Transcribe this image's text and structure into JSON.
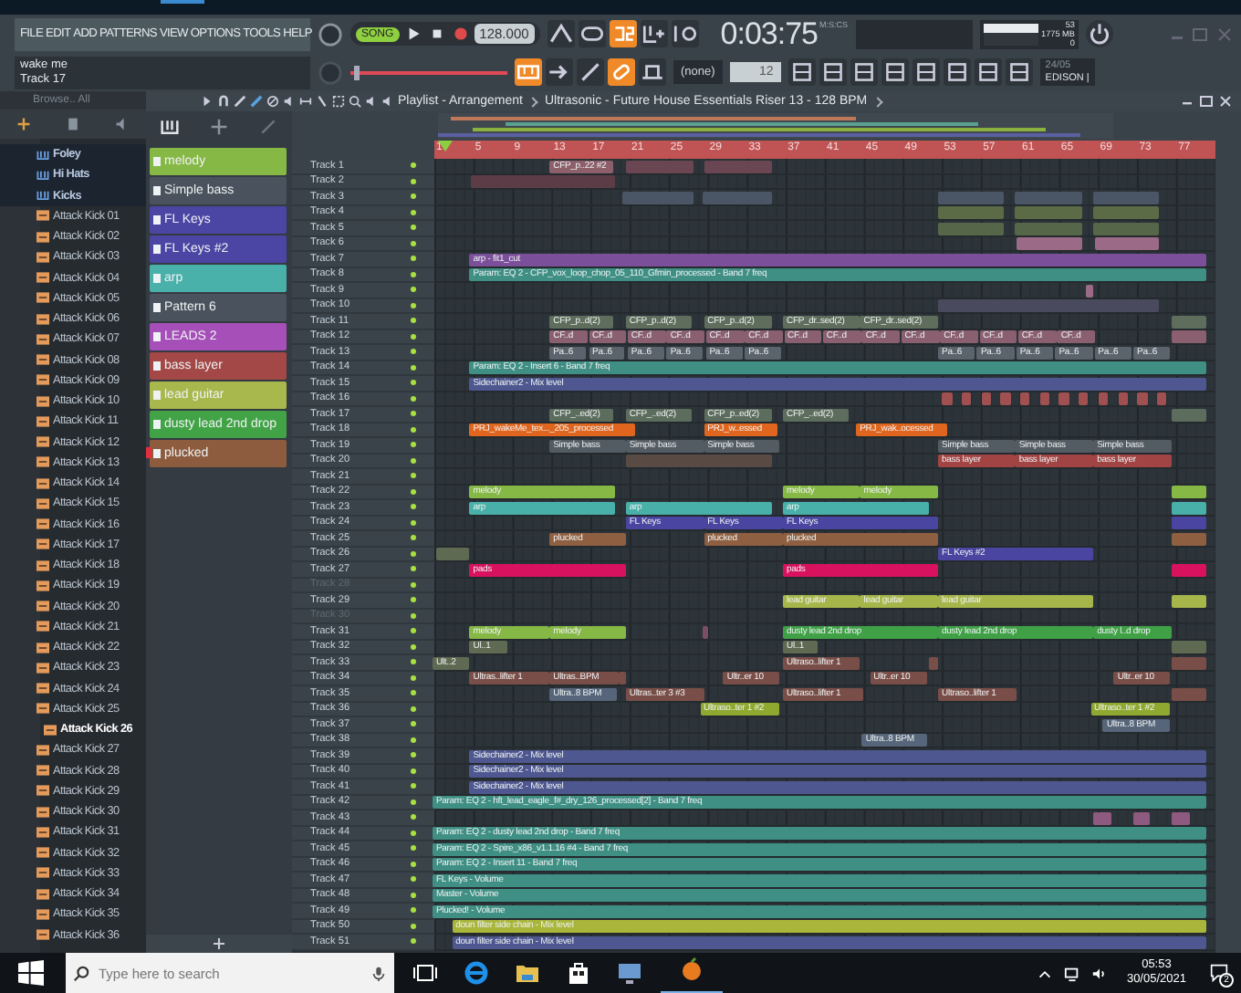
{
  "menu": [
    "FILE",
    "EDIT",
    "ADD",
    "PATTERNS",
    "VIEW",
    "OPTIONS",
    "TOOLS",
    "HELP"
  ],
  "transport": {
    "mode": "SONG",
    "song_mode": true,
    "tempo": "128.000",
    "time": "0:03:75",
    "time_unit": "M:S:CS",
    "cpu": "53",
    "memory": "1775 MB",
    "polyphony": "0"
  },
  "hint": {
    "title": "wake me",
    "subtitle": "Track 17"
  },
  "toolbar": {
    "pitch": {
      "level": 0.02
    },
    "snap": "(none)",
    "step": "12",
    "plugin_date": "24/05",
    "plugin_name": "EDISON |"
  },
  "browser": {
    "header": "Browse.. All",
    "items": [
      {
        "label": "Foley",
        "kind": "folder",
        "selected": false
      },
      {
        "label": "Hi Hats",
        "kind": "folder",
        "selected": false
      },
      {
        "label": "Kicks",
        "kind": "folder",
        "selected": false
      },
      {
        "label": "Attack Kick 01",
        "kind": "file",
        "selected": false
      },
      {
        "label": "Attack Kick 02",
        "kind": "file",
        "selected": false
      },
      {
        "label": "Attack Kick 03",
        "kind": "file",
        "selected": false
      },
      {
        "label": "Attack Kick 04",
        "kind": "file",
        "selected": false
      },
      {
        "label": "Attack Kick 05",
        "kind": "file",
        "selected": false
      },
      {
        "label": "Attack Kick 06",
        "kind": "file",
        "selected": false
      },
      {
        "label": "Attack Kick 07",
        "kind": "file",
        "selected": false
      },
      {
        "label": "Attack Kick 08",
        "kind": "file",
        "selected": false
      },
      {
        "label": "Attack Kick 09",
        "kind": "file",
        "selected": false
      },
      {
        "label": "Attack Kick 10",
        "kind": "file",
        "selected": false
      },
      {
        "label": "Attack Kick 11",
        "kind": "file",
        "selected": false
      },
      {
        "label": "Attack Kick 12",
        "kind": "file",
        "selected": false
      },
      {
        "label": "Attack Kick 13",
        "kind": "file",
        "selected": false
      },
      {
        "label": "Attack Kick 14",
        "kind": "file",
        "selected": false
      },
      {
        "label": "Attack Kick 15",
        "kind": "file",
        "selected": false
      },
      {
        "label": "Attack Kick 16",
        "kind": "file",
        "selected": false
      },
      {
        "label": "Attack Kick 17",
        "kind": "file",
        "selected": false
      },
      {
        "label": "Attack Kick 18",
        "kind": "file",
        "selected": false
      },
      {
        "label": "Attack Kick 19",
        "kind": "file",
        "selected": false
      },
      {
        "label": "Attack Kick 20",
        "kind": "file",
        "selected": false
      },
      {
        "label": "Attack Kick 21",
        "kind": "file",
        "selected": false
      },
      {
        "label": "Attack Kick 22",
        "kind": "file",
        "selected": false
      },
      {
        "label": "Attack Kick 23",
        "kind": "file",
        "selected": false
      },
      {
        "label": "Attack Kick 24",
        "kind": "file",
        "selected": false
      },
      {
        "label": "Attack Kick 25",
        "kind": "file",
        "selected": false
      },
      {
        "label": "Attack Kick 26",
        "kind": "file",
        "selected": true
      },
      {
        "label": "Attack Kick 27",
        "kind": "file",
        "selected": false
      },
      {
        "label": "Attack Kick 28",
        "kind": "file",
        "selected": false
      },
      {
        "label": "Attack Kick 29",
        "kind": "file",
        "selected": false
      },
      {
        "label": "Attack Kick 30",
        "kind": "file",
        "selected": false
      },
      {
        "label": "Attack Kick 31",
        "kind": "file",
        "selected": false
      },
      {
        "label": "Attack Kick 32",
        "kind": "file",
        "selected": false
      },
      {
        "label": "Attack Kick 33",
        "kind": "file",
        "selected": false
      },
      {
        "label": "Attack Kick 34",
        "kind": "file",
        "selected": false
      },
      {
        "label": "Attack Kick 35",
        "kind": "file",
        "selected": false
      },
      {
        "label": "Attack Kick 36",
        "kind": "file",
        "selected": false
      }
    ]
  },
  "patterns": [
    {
      "label": "melody",
      "color": "#86b845",
      "selected": false
    },
    {
      "label": "Simple bass",
      "color": "#4a535d",
      "selected": false
    },
    {
      "label": "FL Keys",
      "color": "#4b45a3",
      "selected": false
    },
    {
      "label": "FL Keys #2",
      "color": "#4b45a3",
      "selected": false
    },
    {
      "label": "arp",
      "color": "#49b0aa",
      "selected": false
    },
    {
      "label": "Pattern 6",
      "color": "#4a535d",
      "selected": false
    },
    {
      "label": "LEADS 2",
      "color": "#a64fb8",
      "selected": false
    },
    {
      "label": "bass layer",
      "color": "#a44747",
      "selected": false
    },
    {
      "label": "lead guitar",
      "color": "#a8b84c",
      "selected": false
    },
    {
      "label": "dusty lead 2nd drop",
      "color": "#41a345",
      "selected": false
    },
    {
      "label": "plucked",
      "color": "#8d5c3f",
      "selected": true
    }
  ],
  "playlist": {
    "title": "Playlist - Arrangement",
    "song": "Ultrasonic - Future House Essentials Riser 13 - 128 BPM",
    "ruler": [
      "1",
      "5",
      "9",
      "13",
      "17",
      "21",
      "25",
      "29",
      "33",
      "37",
      "41",
      "45",
      "49",
      "53",
      "57",
      "61",
      "65",
      "69",
      "73",
      "77"
    ],
    "tracks": [
      {
        "name": "Track 1",
        "muted": false,
        "clips": [
          {
            "label": "CFP_p..22 #2",
            "color": "#8d5f6a"
          },
          {
            "color": "#6a4652"
          },
          {
            "color": "#6a4652"
          }
        ]
      },
      {
        "name": "Track 2",
        "muted": false,
        "clips": [
          {
            "color": "#5c3c46"
          }
        ]
      },
      {
        "name": "Track 3",
        "muted": false,
        "clips": [
          {
            "color": "#4a5566"
          },
          {
            "color": "#4a5566"
          },
          {
            "color": "#4a5566"
          },
          {
            "color": "#4a5566"
          },
          {
            "color": "#4a5566"
          }
        ]
      },
      {
        "name": "Track 4",
        "muted": false,
        "clips": [
          {
            "color": "#5b6b45"
          },
          {
            "color": "#5b6b45"
          },
          {
            "color": "#5b6b45"
          }
        ]
      },
      {
        "name": "Track 5",
        "muted": false,
        "clips": [
          {
            "color": "#566648"
          },
          {
            "color": "#566648"
          },
          {
            "color": "#566648"
          }
        ]
      },
      {
        "name": "Track 6",
        "muted": false,
        "clips": [
          {
            "color": "#9a6a86"
          },
          {
            "color": "#9a6a86"
          }
        ]
      },
      {
        "name": "Track 7",
        "muted": false,
        "clips": [
          {
            "label": "arp - fit1_cut",
            "color": "#7b4f9a"
          }
        ]
      },
      {
        "name": "Track 8",
        "muted": false,
        "clips": [
          {
            "label": "Param: EQ 2 - CFP_vox_loop_chop_05_110_Gfmin_processed - Band 7 freq",
            "color": "#3f8f84"
          }
        ]
      },
      {
        "name": "Track 9",
        "muted": false,
        "clips": [
          {
            "color": "#9a6a86"
          }
        ]
      },
      {
        "name": "Track 10",
        "muted": false,
        "clips": [
          {
            "color": "#4a4a5e"
          }
        ]
      },
      {
        "name": "Track 11",
        "muted": false,
        "clips": [
          {
            "label": "CFP_p..d(2)",
            "color": "#5f6e5c"
          },
          {
            "label": "CFP_p..d(2)",
            "color": "#5f6e5c"
          },
          {
            "label": "CFP_p..d(2)",
            "color": "#5f6e5c"
          },
          {
            "label": "CFP_dr..sed(2)",
            "color": "#5f6e5c"
          },
          {
            "label": "CFP_dr..sed(2)",
            "color": "#5f6e5c"
          },
          {
            "color": "#5f6e5c"
          }
        ]
      },
      {
        "name": "Track 12",
        "muted": false,
        "clips": [
          {
            "label": "CF..d",
            "color": "#8a6070"
          },
          {
            "label": "CF..d",
            "color": "#8a6070"
          },
          {
            "label": "CF..d",
            "color": "#8a6070"
          },
          {
            "label": "CF..d",
            "color": "#8a6070"
          },
          {
            "label": "CF..d",
            "color": "#8a6070"
          },
          {
            "label": "CF..d",
            "color": "#8a6070"
          },
          {
            "label": "CF..d",
            "color": "#8a6070"
          },
          {
            "label": "CF..d",
            "color": "#8a6070"
          },
          {
            "label": "CF..d",
            "color": "#8a6070"
          },
          {
            "label": "CF..d",
            "color": "#8a6070"
          },
          {
            "label": "CF..d",
            "color": "#8a6070"
          },
          {
            "label": "CF..d",
            "color": "#8a6070"
          },
          {
            "label": "CF..d",
            "color": "#8a6070"
          },
          {
            "label": "CF..d",
            "color": "#8a6070"
          },
          {
            "color": "#8a6070"
          }
        ]
      },
      {
        "name": "Track 13",
        "muted": false,
        "clips": [
          {
            "label": "Pa..6",
            "color": "#5b636c"
          },
          {
            "label": "Pa..6",
            "color": "#5b636c"
          },
          {
            "label": "Pa..6",
            "color": "#5b636c"
          },
          {
            "label": "Pa..6",
            "color": "#5b636c"
          },
          {
            "label": "Pa..6",
            "color": "#5b636c"
          },
          {
            "label": "Pa..6",
            "color": "#5b636c"
          },
          {
            "label": "Pa..6",
            "color": "#5b636c"
          },
          {
            "label": "Pa..6",
            "color": "#5b636c"
          },
          {
            "label": "Pa..6",
            "color": "#5b636c"
          },
          {
            "label": "Pa..6",
            "color": "#5b636c"
          },
          {
            "label": "Pa..6",
            "color": "#5b636c"
          },
          {
            "label": "Pa..6",
            "color": "#5b636c"
          }
        ]
      },
      {
        "name": "Track 14",
        "muted": false,
        "clips": [
          {
            "label": "Param: EQ 2 - Insert 6 - Band 7 freq",
            "color": "#3f8f84"
          }
        ]
      },
      {
        "name": "Track 15",
        "muted": false,
        "clips": [
          {
            "label": "Sidechainer2 - Mix level",
            "color": "#4e5790"
          }
        ]
      },
      {
        "name": "Track 16",
        "muted": false,
        "clips": [
          {
            "color": "#a05050"
          },
          {
            "color": "#a05050"
          },
          {
            "color": "#a05050"
          },
          {
            "color": "#a05050"
          },
          {
            "color": "#a05050"
          },
          {
            "color": "#a05050"
          },
          {
            "color": "#a05050"
          },
          {
            "color": "#a05050"
          },
          {
            "color": "#a05050"
          },
          {
            "color": "#a05050"
          },
          {
            "color": "#a05050"
          },
          {
            "color": "#a05050"
          }
        ]
      },
      {
        "name": "Track 17",
        "muted": false,
        "clips": [
          {
            "label": "CFP_..ed(2)",
            "color": "#5d6d5d"
          },
          {
            "label": "CFP_..ed(2)",
            "color": "#5d6d5d"
          },
          {
            "label": "CFP_p..ed(2)",
            "color": "#5d6d5d"
          },
          {
            "label": "CFP_..ed(2)",
            "color": "#5d6d5d"
          },
          {
            "color": "#5d6d5d"
          }
        ]
      },
      {
        "name": "Track 18",
        "muted": false,
        "clips": [
          {
            "label": "PRJ_wakeMe_tex..._205_processed",
            "color": "#e0661f"
          },
          {
            "label": "PRJ_w..essed",
            "color": "#e0661f"
          },
          {
            "label": "PRJ_wak..ocessed",
            "color": "#e0661f"
          }
        ]
      },
      {
        "name": "Track 19",
        "muted": false,
        "clips": [
          {
            "label": "Simple bass",
            "color": "#535b63"
          },
          {
            "label": "Simple bass",
            "color": "#535b63"
          },
          {
            "label": "Simple bass",
            "color": "#535b63"
          },
          {
            "label": "Simple bass",
            "color": "#535b63"
          },
          {
            "label": "Simple bass",
            "color": "#535b63"
          },
          {
            "label": "Simple bass",
            "color": "#535b63"
          }
        ]
      },
      {
        "name": "Track 20",
        "muted": false,
        "clips": [
          {
            "color": "#5a4a44"
          },
          {
            "label": "bass layer",
            "color": "#a24444"
          },
          {
            "label": "bass layer",
            "color": "#a24444"
          },
          {
            "label": "bass layer",
            "color": "#a24444"
          }
        ]
      },
      {
        "name": "Track 21",
        "muted": false
      },
      {
        "name": "Track 22",
        "muted": false,
        "clips": [
          {
            "label": "melody",
            "color": "#86b845"
          },
          {
            "label": "melody",
            "color": "#86b845"
          },
          {
            "label": "melody",
            "color": "#86b845"
          },
          {
            "color": "#86b845"
          }
        ]
      },
      {
        "name": "Track 23",
        "muted": false,
        "clips": [
          {
            "label": "arp",
            "color": "#48b0a8"
          },
          {
            "label": "arp",
            "color": "#48b0a8"
          },
          {
            "label": "arp",
            "color": "#48b0a8"
          },
          {
            "color": "#48b0a8"
          }
        ]
      },
      {
        "name": "Track 24",
        "muted": false,
        "clips": [
          {
            "label": "FL Keys",
            "color": "#4a45a0"
          },
          {
            "label": "FL Keys",
            "color": "#4a45a0"
          },
          {
            "label": "FL Keys",
            "color": "#4a45a0"
          },
          {
            "color": "#4a45a0"
          }
        ]
      },
      {
        "name": "Track 25",
        "muted": false,
        "clips": [
          {
            "label": "plucked",
            "color": "#8e5f40"
          },
          {
            "label": "plucked",
            "color": "#8e5f40"
          },
          {
            "label": "plucked",
            "color": "#8e5f40"
          },
          {
            "color": "#8e5f40"
          }
        ]
      },
      {
        "name": "Track 26",
        "muted": false,
        "clips": [
          {
            "color": "#5e6a52"
          },
          {
            "label": "FL Keys #2",
            "color": "#4a45a0"
          }
        ]
      },
      {
        "name": "Track 27",
        "muted": false,
        "clips": [
          {
            "label": "pads",
            "color": "#d8125e"
          },
          {
            "label": "pads",
            "color": "#d8125e"
          },
          {
            "color": "#d8125e"
          }
        ]
      },
      {
        "name": "Track 28",
        "muted": true
      },
      {
        "name": "Track 29",
        "muted": false,
        "clips": [
          {
            "label": "lead guitar",
            "color": "#a6b64a"
          },
          {
            "label": "lead guitar",
            "color": "#a6b64a"
          },
          {
            "label": "lead guitar",
            "color": "#a6b64a"
          },
          {
            "color": "#a6b64a"
          }
        ]
      },
      {
        "name": "Track 30",
        "muted": true
      },
      {
        "name": "Track 31",
        "muted": false,
        "clips": [
          {
            "label": "melody",
            "color": "#86b845"
          },
          {
            "label": "melody",
            "color": "#86b845"
          },
          {
            "color": "#7a4e68"
          },
          {
            "label": "dusty lead 2nd drop",
            "color": "#3fa046"
          },
          {
            "label": "dusty lead 2nd drop",
            "color": "#3fa046"
          },
          {
            "label": "dusty l..d drop",
            "color": "#3fa046"
          }
        ]
      },
      {
        "name": "Track 32",
        "muted": false,
        "clips": [
          {
            "label": "Ul..1",
            "color": "#5e6a52"
          },
          {
            "label": "Ul..1",
            "color": "#5e6a52"
          },
          {
            "color": "#5e6a52"
          }
        ]
      },
      {
        "name": "Track 33",
        "muted": false,
        "clips": [
          {
            "label": "Ult..2",
            "color": "#5e6a52"
          },
          {
            "label": "Ultraso..lifter 1",
            "color": "#7a4e48"
          },
          {
            "color": "#7a4e48"
          },
          {
            "color": "#7a4e48"
          }
        ]
      },
      {
        "name": "Track 34",
        "muted": false,
        "clips": [
          {
            "label": "Ultras..lifter 1",
            "color": "#7a4e48"
          },
          {
            "label": "Ultras..BPM",
            "color": "#7a4e48"
          },
          {
            "color": "#7a4e48"
          },
          {
            "label": "Ultr..er 10",
            "color": "#7a4e48"
          },
          {
            "label": "Ultr..er 10",
            "color": "#7a4e48"
          },
          {
            "label": "Ultr..er 10",
            "color": "#7a4e48"
          }
        ]
      },
      {
        "name": "Track 35",
        "muted": false,
        "clips": [
          {
            "label": "Ultra..8 BPM",
            "color": "#56657a"
          },
          {
            "label": "Ultras..ter 3 #3",
            "color": "#7a4e48"
          },
          {
            "label": "Ultraso..lifter 1",
            "color": "#7a4e48"
          },
          {
            "label": "Ultraso..lifter 1",
            "color": "#7a4e48"
          },
          {
            "color": "#7a4e48"
          }
        ]
      },
      {
        "name": "Track 36",
        "muted": false,
        "clips": [
          {
            "label": "Ultraso..ter 1 #2",
            "color": "#8fa830"
          },
          {
            "label": "Ultraso..ter 1 #2",
            "color": "#8fa830"
          }
        ]
      },
      {
        "name": "Track 37",
        "muted": false,
        "clips": [
          {
            "label": "Ultra..8 BPM",
            "color": "#56657a"
          }
        ]
      },
      {
        "name": "Track 38",
        "muted": false,
        "clips": [
          {
            "label": "Ultra..8 BPM",
            "color": "#56657a"
          }
        ]
      },
      {
        "name": "Track 39",
        "muted": false,
        "clips": [
          {
            "label": "Sidechainer2 - Mix level",
            "color": "#4e5790"
          }
        ]
      },
      {
        "name": "Track 40",
        "muted": false,
        "clips": [
          {
            "label": "Sidechainer2 - Mix level",
            "color": "#4e5790"
          }
        ]
      },
      {
        "name": "Track 41",
        "muted": false,
        "clips": [
          {
            "label": "Sidechainer2 - Mix level",
            "color": "#4e5790"
          }
        ]
      },
      {
        "name": "Track 42",
        "muted": false,
        "clips": [
          {
            "label": "Param: EQ 2 - hft_lead_eagle_f#_dry_126_processed[2] - Band 7 freq",
            "color": "#3f8f84"
          }
        ]
      },
      {
        "name": "Track 43",
        "muted": false,
        "clips": [
          {
            "color": "#8e5a80"
          },
          {
            "color": "#8e5a80"
          },
          {
            "color": "#8e5a80"
          }
        ]
      },
      {
        "name": "Track 44",
        "muted": false,
        "clips": [
          {
            "label": "Param: EQ 2 - dusty lead 2nd drop - Band 7 freq",
            "color": "#3f8f84"
          }
        ]
      },
      {
        "name": "Track 45",
        "muted": false,
        "clips": [
          {
            "label": "Param: EQ 2 - Spire_x86_v1.1.16 #4 - Band 7 freq",
            "color": "#3f8f84"
          }
        ]
      },
      {
        "name": "Track 46",
        "muted": false,
        "clips": [
          {
            "label": "Param: EQ 2 - Insert 11 - Band 7 freq",
            "color": "#3f8f84"
          }
        ]
      },
      {
        "name": "Track 47",
        "muted": false,
        "clips": [
          {
            "label": "FL Keys - Volume",
            "color": "#3f8f84"
          }
        ]
      },
      {
        "name": "Track 48",
        "muted": false,
        "clips": [
          {
            "label": "Master - Volume",
            "color": "#3f8f84"
          }
        ]
      },
      {
        "name": "Track 49",
        "muted": false,
        "clips": [
          {
            "label": "Plucked! - Volume",
            "color": "#3f8f84"
          }
        ]
      },
      {
        "name": "Track 50",
        "muted": false,
        "clips": [
          {
            "label": "doun filter side chain - Mix level",
            "color": "#a9b63a"
          }
        ]
      },
      {
        "name": "Track 51",
        "muted": false,
        "clips": [
          {
            "label": "doun filter side chain - Mix level",
            "color": "#4e5790"
          }
        ]
      }
    ]
  },
  "taskbar": {
    "search_placeholder": "Type here to search",
    "time": "05:53",
    "date": "30/05/2021",
    "notifications": "2"
  }
}
